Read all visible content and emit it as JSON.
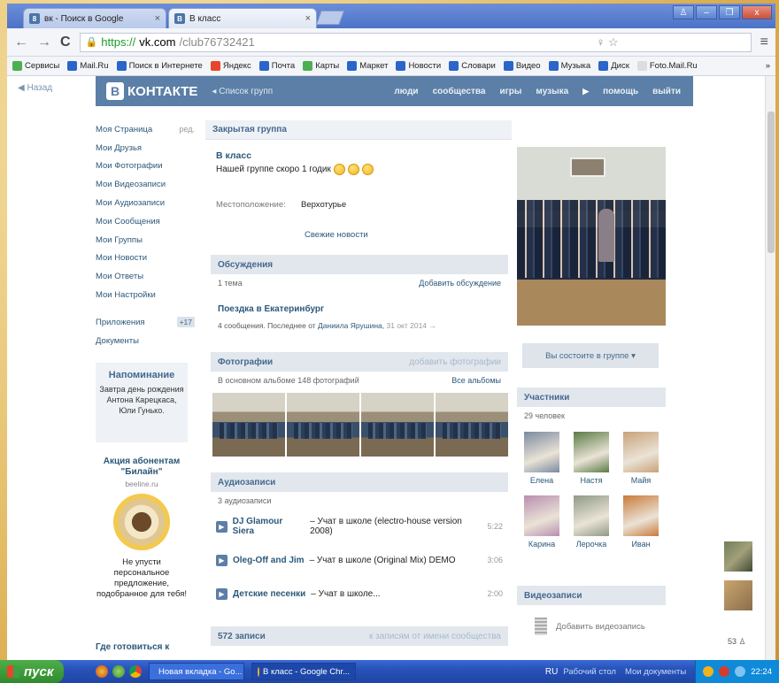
{
  "browser": {
    "tabs": [
      {
        "label": "вк - Поиск в Google",
        "favicon": "8"
      },
      {
        "label": "В класс",
        "favicon": "B"
      }
    ],
    "url": {
      "scheme": "https://",
      "host": "vk.com",
      "path": "/club76732421"
    },
    "bookmarks": [
      {
        "label": "Сервисы",
        "color": "#4caf50"
      },
      {
        "label": "Mail.Ru",
        "color": "#2a66c9"
      },
      {
        "label": "Поиск в Интернете",
        "color": "#2a66c9"
      },
      {
        "label": "Яндекс",
        "color": "#e8452c"
      },
      {
        "label": "Почта",
        "color": "#2a66c9"
      },
      {
        "label": "Карты",
        "color": "#4caf50"
      },
      {
        "label": "Маркет",
        "color": "#2a66c9"
      },
      {
        "label": "Новости",
        "color": "#2a66c9"
      },
      {
        "label": "Словари",
        "color": "#2a66c9"
      },
      {
        "label": "Видео",
        "color": "#2a66c9"
      },
      {
        "label": "Музыка",
        "color": "#2a66c9"
      },
      {
        "label": "Диск",
        "color": "#2a66c9"
      },
      {
        "label": "Foto.Mail.Ru",
        "color": "#dddddd"
      }
    ],
    "more": "»"
  },
  "vk": {
    "back": "Назад",
    "logo_letter": "В",
    "logo_text": "КОНТАКТЕ",
    "list_groups": "Список групп",
    "nav": [
      "люди",
      "сообщества",
      "игры",
      "музыка",
      "помощь",
      "выйти"
    ],
    "menu": [
      {
        "label": "Моя Страница",
        "extra": "ред."
      },
      {
        "label": "Мои Друзья"
      },
      {
        "label": "Мои Фотографии"
      },
      {
        "label": "Мои Видеозаписи"
      },
      {
        "label": "Мои Аудиозаписи"
      },
      {
        "label": "Мои Сообщения"
      },
      {
        "label": "Мои Группы"
      },
      {
        "label": "Мои Новости"
      },
      {
        "label": "Мои Ответы"
      },
      {
        "label": "Мои Настройки"
      }
    ],
    "apps": {
      "label": "Приложения",
      "count": "+17"
    },
    "docs": "Документы",
    "reminder": {
      "title": "Напоминание",
      "text": "Завтра день рождения Антона Карецкаса, Юли Гунько."
    },
    "ad": {
      "title": "Акция абонентам \"Билайн\"",
      "site": "beeline.ru",
      "text": "Не упусти персональное предложение, подобранное для тебя!"
    },
    "where_label": "Где готовиться к",
    "group": {
      "type": "Закрытая группа",
      "name": "В класс",
      "status": "Нашей группе скоро 1 годик",
      "location_label": "Местоположение:",
      "location_value": "Верхотурье",
      "news_link": "Свежие новости"
    },
    "discussions": {
      "title": "Обсуждения",
      "count": "1 тема",
      "add": "Добавить обсуждение",
      "thread_title": "Поездка в Екатеринбург",
      "thread_meta": "4 сообщения. Последнее от",
      "thread_author": "Даниила Ярушина,",
      "thread_date": "31 окт 2014"
    },
    "photos": {
      "title": "Фотографии",
      "add": "добавить фотографии",
      "count": "В основном альбоме 148 фотографий",
      "all": "Все альбомы"
    },
    "audio": {
      "title": "Аудиозаписи",
      "count": "3 аудиозаписи",
      "tracks": [
        {
          "artist": "DJ Glamour Siera",
          "title": "– Учат в школе (electro-house version 2008)",
          "duration": "5:22"
        },
        {
          "artist": "Oleg-Off and Jim",
          "title": "– Учат в школе (Original Mix) DEMO",
          "duration": "3:06"
        },
        {
          "artist": "Детские песенки",
          "title": "– Учат в школе...",
          "duration": "2:00"
        }
      ]
    },
    "posts": {
      "count": "572 записи",
      "link": "к записям от имени сообщества"
    },
    "member_button": "Вы состоите в группе ▾",
    "members": {
      "title": "Участники",
      "count": "29 человек",
      "people": [
        {
          "name": "Елена",
          "color": "#7b8aa0"
        },
        {
          "name": "Настя",
          "color": "#5a7a45"
        },
        {
          "name": "Майя",
          "color": "#c9a27a"
        },
        {
          "name": "Карина",
          "color": "#b88fb0"
        },
        {
          "name": "Лерочка",
          "color": "#8f9a86"
        },
        {
          "name": "Иван",
          "color": "#c97a3a"
        }
      ]
    },
    "videos": {
      "title": "Видеозаписи",
      "add": "Добавить видеозапись"
    },
    "online_count": "53"
  },
  "taskbar": {
    "start": "пуск",
    "tasks": [
      {
        "label": "Новая вкладка - Go..."
      },
      {
        "label": "В класс - Google Chr..."
      }
    ],
    "lang": "RU",
    "desk1": "Рабочий стол",
    "desk2": "Мои документы",
    "time": "22:24"
  }
}
